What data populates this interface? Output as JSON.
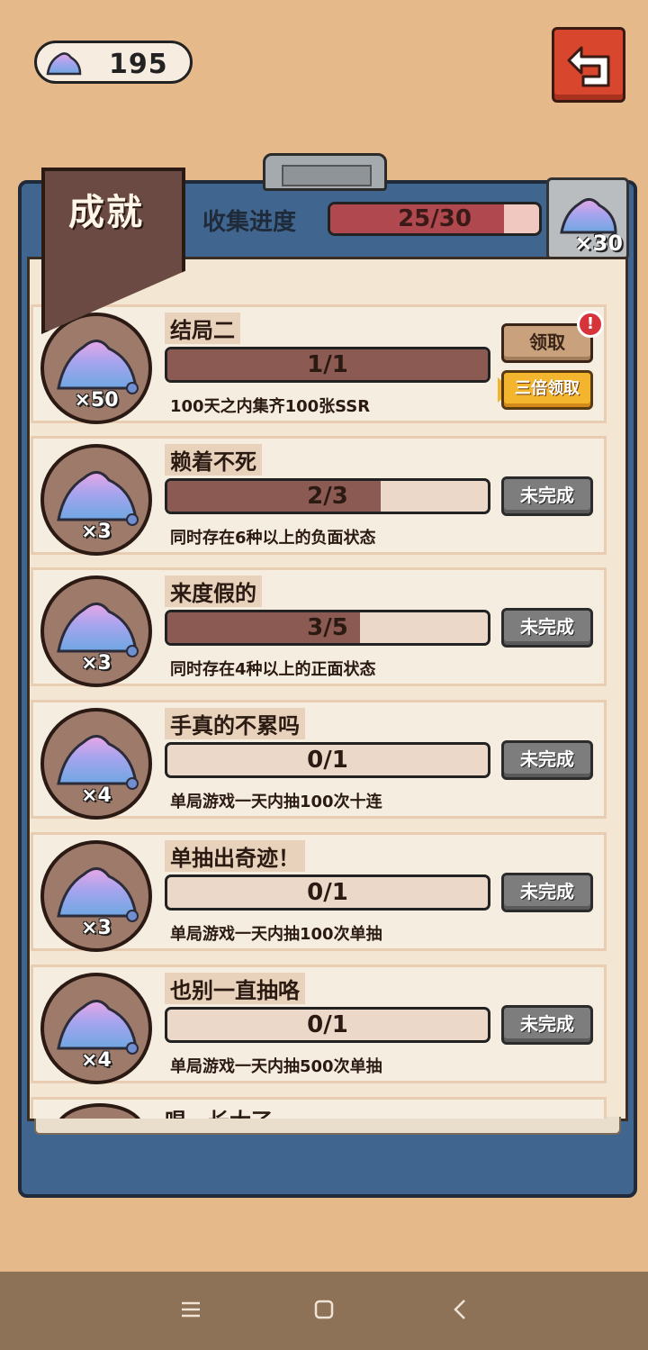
{
  "currency": {
    "value": "195",
    "icon": "crystal-gem-icon"
  },
  "back_button": {
    "icon": "back-arrow-icon"
  },
  "header": {
    "title": "成就",
    "progress_label": "收集进度",
    "progress_text": "25/30",
    "progress_fraction": 0.833,
    "reward_qty": "×30"
  },
  "achievements": [
    {
      "title": "结局二",
      "progress": "1/1",
      "fraction": 1.0,
      "desc": "100天之内集齐100张SSR",
      "reward": "×50",
      "status": "claimable",
      "claim_label": "领取",
      "triple_label": "三倍领取",
      "badge": "!"
    },
    {
      "title": "赖着不死",
      "progress": "2/3",
      "fraction": 0.667,
      "desc": "同时存在6种以上的负面状态",
      "reward": "×3",
      "status": "incomplete",
      "btn_label": "未完成"
    },
    {
      "title": "来度假的",
      "progress": "3/5",
      "fraction": 0.6,
      "desc": "同时存在4种以上的正面状态",
      "reward": "×3",
      "status": "incomplete",
      "btn_label": "未完成"
    },
    {
      "title": "手真的不累吗",
      "progress": "0/1",
      "fraction": 0.0,
      "desc": "单局游戏一天内抽100次十连",
      "reward": "×4",
      "status": "incomplete",
      "btn_label": "未完成"
    },
    {
      "title": "单抽出奇迹！",
      "progress": "0/1",
      "fraction": 0.0,
      "desc": "单局游戏一天内抽100次单抽",
      "reward": "×3",
      "status": "incomplete",
      "btn_label": "未完成"
    },
    {
      "title": "也别一直抽咯",
      "progress": "0/1",
      "fraction": 0.0,
      "desc": "单局游戏一天内抽500次单抽",
      "reward": "×4",
      "status": "incomplete",
      "btn_label": "未完成"
    }
  ],
  "partial_card": {
    "title": "唱，长大了"
  },
  "navbar": {
    "menu_icon": "menu-icon",
    "home_icon": "home-square-icon",
    "back_icon": "nav-back-icon"
  },
  "colors": {
    "background": "#e6b98a",
    "board": "#40658e",
    "progress_fill": "#b04850",
    "task_fill": "#8b5a52",
    "triple_button": "#f3b52d"
  }
}
